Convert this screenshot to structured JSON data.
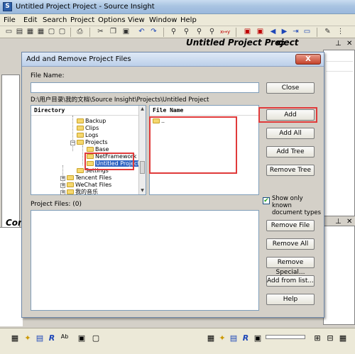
{
  "window": {
    "title": "Untitled Project Project - Source Insight",
    "menu": [
      "File",
      "Edit",
      "Search",
      "Project",
      "Options",
      "View",
      "Window",
      "Help"
    ]
  },
  "background": {
    "project_pane_title": "Untitled Project Project",
    "context_pane_title": "Con"
  },
  "dialog": {
    "title": "Add and Remove Project Files",
    "close_glyph": "X",
    "file_name_label": "File Name:",
    "file_name_value": "",
    "current_path": "D:\\用户目录\\我的文档\\Source Insight\\Projects\\Untitled Project",
    "directory_header": "Directory",
    "file_name_header": "File Name",
    "tree": [
      {
        "label": "Backup",
        "selected": false
      },
      {
        "label": "Clips",
        "selected": false
      },
      {
        "label": "Logs",
        "selected": false
      },
      {
        "label": "Projects",
        "selected": false
      },
      {
        "label": "Base",
        "selected": false
      },
      {
        "label": "NetFramework",
        "selected": false
      },
      {
        "label": "Untitled Project",
        "selected": true
      },
      {
        "label": "Settings",
        "selected": false
      },
      {
        "label": "Tencent Files",
        "selected": false
      },
      {
        "label": "WeChat Files",
        "selected": false
      },
      {
        "label": "我的音乐",
        "selected": false
      }
    ],
    "file_list": [
      ".."
    ],
    "project_files_label": "Project Files: (0)",
    "buttons": {
      "close": "Close",
      "add": "Add",
      "add_all": "Add All",
      "add_tree": "Add Tree",
      "remove_tree": "Remove Tree",
      "remove_file": "Remove File",
      "remove_all": "Remove All",
      "remove_special": "Remove Special...",
      "add_from_list": "Add from list...",
      "help": "Help"
    },
    "show_only_known": {
      "label": "Show only known document types",
      "checked": true
    }
  },
  "colors": {
    "highlight_box": "#e03a3a",
    "selection": "#3165c3"
  }
}
